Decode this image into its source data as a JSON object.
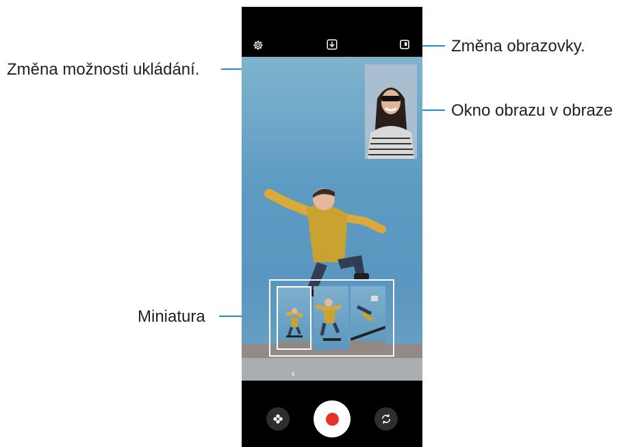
{
  "callouts": {
    "save_option": "Změna možnosti ukládání.",
    "screen_change": "Změna obrazovky.",
    "pip_window": "Okno obrazu v obraze",
    "thumbnail": "Miniatura"
  },
  "camera": {
    "top_icons": [
      "gear-icon",
      "download-icon",
      "pip-layout-icon"
    ],
    "preview_arrow": "‹",
    "bottom_icons": [
      "filter-icon",
      "record-button",
      "flip-camera-icon"
    ],
    "record_color": "#e4322b",
    "accent_color": "#1a8fd0"
  }
}
